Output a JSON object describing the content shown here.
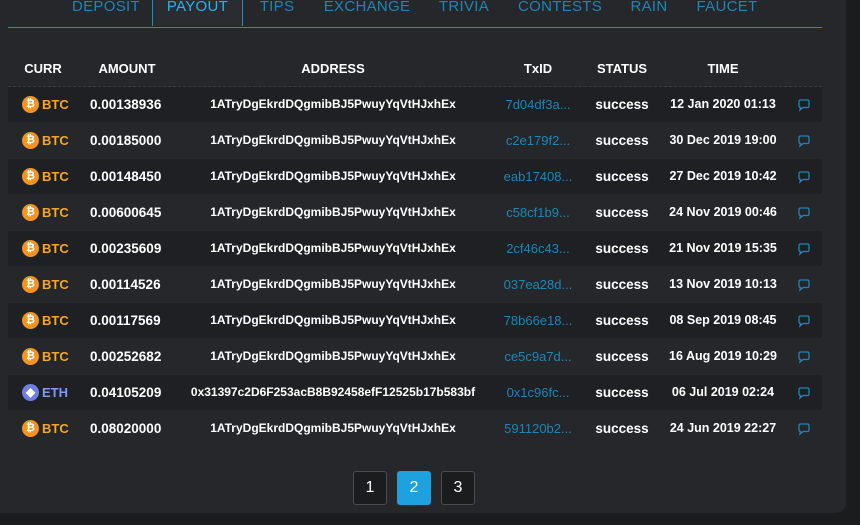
{
  "tabs": [
    {
      "label": "DEPOSIT"
    },
    {
      "label": "PAYOUT",
      "active": true
    },
    {
      "label": "TIPS"
    },
    {
      "label": "EXCHANGE"
    },
    {
      "label": "TRIVIA"
    },
    {
      "label": "CONTESTS"
    },
    {
      "label": "RAIN"
    },
    {
      "label": "FAUCET"
    }
  ],
  "table": {
    "headers": {
      "curr": "CURR",
      "amount": "AMOUNT",
      "address": "ADDRESS",
      "txid": "TxID",
      "status": "STATUS",
      "time": "TIME"
    },
    "rows": [
      {
        "coin": "btc",
        "curr": "BTC",
        "amount": "0.00138936",
        "address": "1ATryDgEkrdDQgmibBJ5PwuyYqVtHJxhEx",
        "txid": "7d04df3a...",
        "status": "success",
        "time": "12 Jan 2020 01:13"
      },
      {
        "coin": "btc",
        "curr": "BTC",
        "amount": "0.00185000",
        "address": "1ATryDgEkrdDQgmibBJ5PwuyYqVtHJxhEx",
        "txid": "c2e179f2...",
        "status": "success",
        "time": "30 Dec 2019 19:00"
      },
      {
        "coin": "btc",
        "curr": "BTC",
        "amount": "0.00148450",
        "address": "1ATryDgEkrdDQgmibBJ5PwuyYqVtHJxhEx",
        "txid": "eab17408...",
        "status": "success",
        "time": "27 Dec 2019 10:42"
      },
      {
        "coin": "btc",
        "curr": "BTC",
        "amount": "0.00600645",
        "address": "1ATryDgEkrdDQgmibBJ5PwuyYqVtHJxhEx",
        "txid": "c58cf1b9...",
        "status": "success",
        "time": "24 Nov 2019 00:46"
      },
      {
        "coin": "btc",
        "curr": "BTC",
        "amount": "0.00235609",
        "address": "1ATryDgEkrdDQgmibBJ5PwuyYqVtHJxhEx",
        "txid": "2cf46c43...",
        "status": "success",
        "time": "21 Nov 2019 15:35"
      },
      {
        "coin": "btc",
        "curr": "BTC",
        "amount": "0.00114526",
        "address": "1ATryDgEkrdDQgmibBJ5PwuyYqVtHJxhEx",
        "txid": "037ea28d...",
        "status": "success",
        "time": "13 Nov 2019 10:13"
      },
      {
        "coin": "btc",
        "curr": "BTC",
        "amount": "0.00117569",
        "address": "1ATryDgEkrdDQgmibBJ5PwuyYqVtHJxhEx",
        "txid": "78b66e18...",
        "status": "success",
        "time": "08 Sep 2019 08:45"
      },
      {
        "coin": "btc",
        "curr": "BTC",
        "amount": "0.00252682",
        "address": "1ATryDgEkrdDQgmibBJ5PwuyYqVtHJxhEx",
        "txid": "ce5c9a7d...",
        "status": "success",
        "time": "16 Aug 2019 10:29"
      },
      {
        "coin": "eth",
        "curr": "ETH",
        "amount": "0.04105209",
        "address": "0x31397c2D6F253acB8B92458efF12525b17b583bf",
        "txid": "0x1c96fc...",
        "status": "success",
        "time": "06 Jul 2019 02:24"
      },
      {
        "coin": "btc",
        "curr": "BTC",
        "amount": "0.08020000",
        "address": "1ATryDgEkrdDQgmibBJ5PwuyYqVtHJxhEx",
        "txid": "591120b2...",
        "status": "success",
        "time": "24 Jun 2019 22:27"
      }
    ]
  },
  "pagination": {
    "pages": [
      "1",
      "2",
      "3"
    ],
    "current": "2"
  },
  "colors": {
    "accent": "#1ea1de",
    "btc": "#f5a623",
    "eth": "#7f9cf5",
    "link": "#1d86b6"
  }
}
